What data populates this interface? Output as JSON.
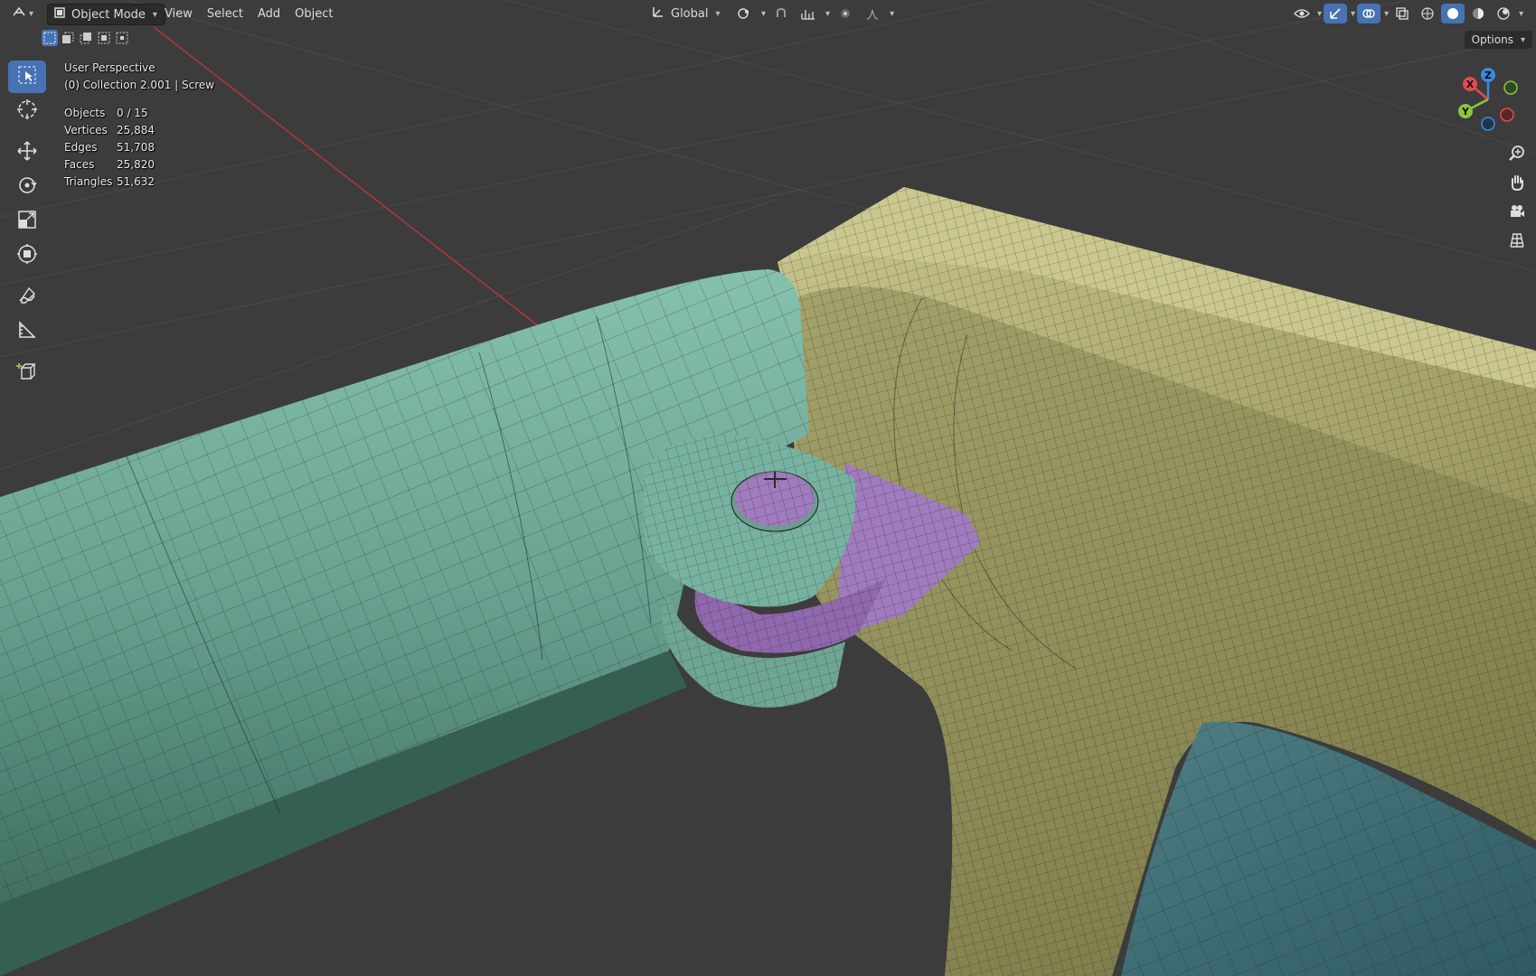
{
  "header": {
    "editor_icon": "3d-viewport-icon",
    "mode_label": "Object Mode",
    "menus": [
      "View",
      "Select",
      "Add",
      "Object"
    ],
    "transform_orientation": "Global",
    "options_label": "Options"
  },
  "overlay": {
    "view_name": "User Perspective",
    "collection_info": "(0) Collection 2.001 | Screw",
    "stats": [
      {
        "label": "Objects",
        "value": "0 / 15"
      },
      {
        "label": "Vertices",
        "value": "25,884"
      },
      {
        "label": "Edges",
        "value": "51,708"
      },
      {
        "label": "Faces",
        "value": "25,820"
      },
      {
        "label": "Triangles",
        "value": "51,632"
      }
    ]
  },
  "gizmo": {
    "x_label": "X",
    "y_label": "Y",
    "z_label": "Z"
  },
  "tools": [
    "select-box-icon",
    "cursor-icon",
    "move-icon",
    "rotate-icon",
    "scale-icon",
    "transform-icon",
    "annotate-icon",
    "measure-icon",
    "add-cube-icon"
  ],
  "nav_buttons": [
    "zoom-icon",
    "hand-pan-icon",
    "camera-icon",
    "grid-ortho-icon"
  ],
  "colors": {
    "background": "#3c3c3c",
    "teal_mesh": "#6fa595",
    "yellow_mesh": "#a8a76a",
    "purple_mesh": "#a07bbd",
    "accent": "#4772b3",
    "axis_x": "#e44a4f",
    "axis_y": "#8cc63f",
    "axis_z": "#3c89e0"
  }
}
